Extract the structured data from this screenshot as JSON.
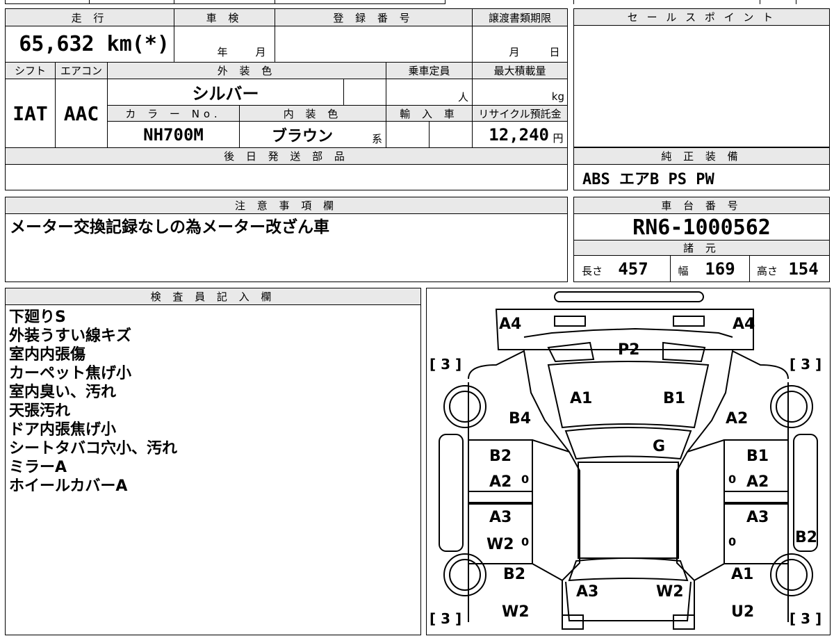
{
  "top_block": {
    "mileage_header": "走 行",
    "mileage_value": "65,632 km(*)",
    "inspection_header": "車 検",
    "inspection_year": "年",
    "inspection_month": "月",
    "registration_header": "登 録 番 号",
    "transfer_header": "譲渡書類期限",
    "transfer_month": "月",
    "transfer_day": "日",
    "shift_header": "シフト",
    "shift_value": "IAT",
    "ac_header": "エアコン",
    "ac_value": "AAC",
    "exterior_color_header": "外 装 色",
    "exterior_color_value": "シルバー",
    "capacity_header": "乗車定員",
    "capacity_unit": "人",
    "max_load_header": "最大積載量",
    "max_load_unit": "kg",
    "color_no_header": "カ ラ ー No.",
    "color_no_value": "NH700M",
    "interior_color_header": "内 装 色",
    "interior_color_value": "ブラウン",
    "interior_color_suffix": "系",
    "import_header": "輸 入 車",
    "recycle_header": "リサイクル預託金",
    "recycle_value": "12,240",
    "recycle_unit": "円",
    "later_parts_header": "後 日 発 送 部 品"
  },
  "sales_point": {
    "header": "セ ー ル ス ポ イ ン ト"
  },
  "genuine_equipment": {
    "header": "純 正 装 備",
    "value": "ABS エアB PS PW"
  },
  "notes": {
    "header": "注 意 事 項 欄",
    "text": "メーター交換記録なしの為メーター改ざん車"
  },
  "chassis": {
    "header": "車 台 番 号",
    "value": "RN6-1000562",
    "spec_header": "諸 元",
    "length_label": "長さ",
    "length_value": "457",
    "width_label": "幅",
    "width_value": "169",
    "height_label": "高さ",
    "height_value": "154"
  },
  "inspector": {
    "header": "検 査 員 記 入 欄",
    "lines": [
      "下廻りS",
      "外装うすい線キズ",
      "室内内張傷",
      "カーペット焦げ小",
      "室内臭い、汚れ",
      "天張汚れ",
      "ドア内張焦げ小",
      "シートタバコ穴小、汚れ",
      "ミラーA",
      "ホイールカバーA"
    ]
  },
  "diagram": {
    "marks": {
      "front_left": "A4",
      "front_right": "A4",
      "grille": "P2",
      "hood_left": "A1",
      "hood_right": "B1",
      "left_front_fender": "B4",
      "right_front_fender": "A2",
      "windshield": "G",
      "left_front_door_1": "B2",
      "left_front_door_2": "A2",
      "right_front_door_1": "B1",
      "right_front_door_2": "A2",
      "left_rear_door_1": "A3",
      "left_rear_door_2": "W2",
      "right_rear_door": "A3",
      "right_rear_side": "B2",
      "left_rear_fender": "B2",
      "left_rear_lower": "W2",
      "rear_left": "A3",
      "rear_right": "W2",
      "right_rear_fender": "A1",
      "right_rear_lower": "U2",
      "tire_top_left": "[ 3 ]",
      "tire_top_right": "[ 3 ]",
      "tire_bottom_left": "[ 3 ]",
      "tire_bottom_right": "[ 3 ]",
      "zero_1": "0",
      "zero_2": "0",
      "zero_3": "0",
      "zero_4": "0"
    }
  }
}
